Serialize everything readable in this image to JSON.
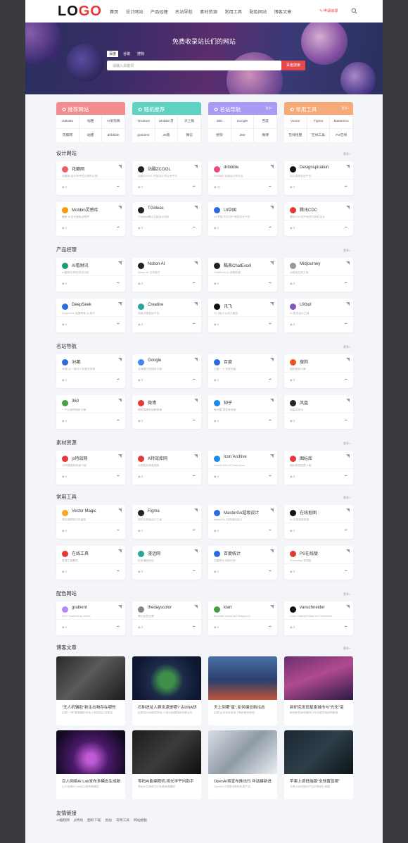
{
  "header": {
    "logo_a": "LO",
    "logo_b": "GO",
    "nav": [
      "首页",
      "设计网站",
      "产品经理",
      "名站导航",
      "素材资源",
      "常用工具",
      "配色网站",
      "博客文章"
    ],
    "apply": "✎ 申请收录"
  },
  "hero": {
    "title": "免费收录站长们的网站",
    "tabs": [
      "百度",
      "谷歌",
      "搜狗"
    ],
    "placeholder": "请输入关键词",
    "button": "百度搜索"
  },
  "categories": [
    {
      "title": "推荐网站",
      "color": "#f48b8e",
      "more": "",
      "items": [
        "JoBoBo",
        "站酷",
        "AI发现阁",
        "花瓣网",
        "站酷",
        "dribbble"
      ]
    },
    {
      "title": "随机推荐",
      "color": "#5fd3c3",
      "more": "",
      "items": [
        "TGideas",
        "Mobbin灵",
        "天上助",
        "grabient",
        "36氪",
        "微信"
      ]
    },
    {
      "title": "名站导航",
      "color": "#a99af5",
      "more": "更多+",
      "items": [
        "360",
        "Google",
        "百度",
        "搜狗",
        "360",
        "微博"
      ]
    },
    {
      "title": "常用工具",
      "color": "#f7aa78",
      "more": "更多+",
      "items": [
        "Vector",
        "Figma",
        "MasterGo",
        "在线抠图",
        "在线工具",
        "PS在线"
      ]
    }
  ],
  "more_label": "更多+",
  "sections": [
    {
      "title": "设计网站",
      "cards": [
        {
          "name": "花瓣网",
          "desc": "花瓣网,设计师寻找灵感的天堂!",
          "views": "0",
          "color": "#ef5f6a"
        },
        {
          "name": "站酷ZCOOL",
          "desc": "站酷ZCOOL,中国设计师互动平台",
          "views": "0",
          "color": "#222"
        },
        {
          "name": "dribbble",
          "desc": "Dribbble 全球设计师社区",
          "views": "41",
          "color": "#ea4c89"
        },
        {
          "name": "Designspiration",
          "desc": "设计灵感发现平台",
          "views": "0",
          "color": "#111"
        },
        {
          "name": "Mobbin灵感库",
          "desc": "最新 UI设计模板灵感库",
          "views": "0",
          "color": "#f39c12"
        },
        {
          "name": "TGideas",
          "desc": "TGideas腾讯互娱设计团队",
          "views": "0",
          "color": "#222"
        },
        {
          "name": "UI中国",
          "desc": "UI 中国,专业用户体验设计平台",
          "views": "0",
          "color": "#2d6cdf"
        },
        {
          "name": "腾讯CDC",
          "desc": "腾讯CDC用户研究与体验设计",
          "views": "0",
          "color": "#e53935"
        }
      ]
    },
    {
      "title": "产品经理",
      "cards": [
        {
          "name": "AI看财讯",
          "desc": "AI看财讯,财经资讯分析",
          "views": "0",
          "color": "#1b9e77"
        },
        {
          "name": "Notion AI",
          "desc": "Notion AI 写作助手",
          "views": "0",
          "color": "#222"
        },
        {
          "name": "酷表ChatExcel",
          "desc": "ChatExcel AI 表格处理",
          "views": "0",
          "color": "#222"
        },
        {
          "name": "Midjourney",
          "desc": "AI绘画生成工具",
          "views": "0",
          "color": "#999"
        },
        {
          "name": "DeepSeek",
          "desc": "DeepSeek 深度求索 AI 助手",
          "views": "0",
          "color": "#2d6cdf"
        },
        {
          "name": "Creative",
          "desc": "创意灵感发现平台",
          "views": "0",
          "color": "#26a69a"
        },
        {
          "name": "讯飞",
          "desc": "讯飞星火认知大模型",
          "views": "0",
          "color": "#111"
        },
        {
          "name": "UXbot",
          "desc": "AI 原型设计工具",
          "views": "0",
          "color": "#7e57c2"
        }
      ]
    },
    {
      "title": "名站导航",
      "cards": [
        {
          "name": "36氪",
          "desc": "36氪,让一部分人先看到未来",
          "views": "0",
          "color": "#2d6cdf"
        },
        {
          "name": "Google",
          "desc": "全球最大的搜索引擎",
          "views": "0",
          "color": "#4285f4"
        },
        {
          "name": "百度",
          "desc": "百度一下,你就知道",
          "views": "0",
          "color": "#2d6cdf"
        },
        {
          "name": "搜狗",
          "desc": "搜狗搜索引擎",
          "views": "0",
          "color": "#f4511e"
        },
        {
          "name": "360",
          "desc": "一个正经的搜索引擎",
          "views": "0",
          "color": "#43a047"
        },
        {
          "name": "微博",
          "desc": "随时随地发现新鲜事",
          "views": "0",
          "color": "#e53935"
        },
        {
          "name": "知乎",
          "desc": "有问题,就会有答案",
          "views": "0",
          "color": "#1e88e5"
        },
        {
          "name": "凤凰",
          "desc": "凤凰网资讯",
          "views": "0",
          "color": "#222"
        }
      ]
    },
    {
      "title": "素材资源",
      "cards": [
        {
          "name": "js特效网",
          "desc": "JS特效素材资源下载",
          "views": "0",
          "color": "#e53935"
        },
        {
          "name": "A特效库网",
          "desc": "AI特效资源素材库",
          "views": "0",
          "color": "#e53935"
        },
        {
          "name": "Icon Archive",
          "desc": "Search 590,673 free icons",
          "views": "1",
          "color": "#1e88e5"
        },
        {
          "name": "图标库",
          "desc": "图标素材免费下载",
          "views": "0",
          "color": "#e53935"
        }
      ]
    },
    {
      "title": "常用工具",
      "cards": [
        {
          "name": "Vector Magic",
          "desc": "将位图转换为矢量图",
          "views": "0",
          "color": "#f9a825"
        },
        {
          "name": "Figma",
          "desc": "协作式界面设计工具",
          "views": "0",
          "color": "#222"
        },
        {
          "name": "MasterGo超级设计",
          "desc": "MasterGo 在线协同设计",
          "views": "0",
          "color": "#2d6cdf"
        },
        {
          "name": "在线抠图",
          "desc": "AI 在线智能抠图",
          "views": "0",
          "color": "#111"
        },
        {
          "name": "在线工具",
          "desc": "在线工具集合",
          "views": "0",
          "color": "#e53935"
        },
        {
          "name": "漫话网",
          "desc": "在线漫画阅读",
          "views": "0",
          "color": "#26a69a"
        },
        {
          "name": "百度统计",
          "desc": "百度统计 网站分析",
          "views": "0",
          "color": "#2d6cdf"
        },
        {
          "name": "PS在线版",
          "desc": "Photoshop 在线版",
          "views": "0",
          "color": "#e53935"
        }
      ]
    },
    {
      "title": "配色网站",
      "cards": [
        {
          "name": "grabient",
          "desc": "2017 Grabient by unfold",
          "views": "0",
          "color": "#b388ff"
        },
        {
          "name": "thedayscolor",
          "desc": "每日配色灵感",
          "views": "0",
          "color": "#888"
        },
        {
          "name": "klart",
          "desc": "Beautiful colors and designs to",
          "views": "0",
          "color": "#43a047"
        },
        {
          "name": "vanschneider",
          "desc": "Color Claim@Tobias van Schneider",
          "views": "0",
          "color": "#111"
        }
      ]
    }
  ],
  "blog_title": "博客文章",
  "blogs": [
    {
      "title": "\"无人机辅助\"新生出物存在哪些",
      "desc": "近期,一种\"增强辅助\"的无人机应用正在热议",
      "bg": "linear-gradient(135deg,#2a2a2a,#5a5a5a 45%,#1b1b1b)"
    },
    {
      "title": "石斛进址人群发源是哪? 古DNA研",
      "desc": "近期古DNA研究发现,人类迁徙路线再次被证实",
      "bg": "radial-gradient(circle at 50% 55%,#3e8f4a 18%,#1d2b4a 40%,#0f1730 80%)"
    },
    {
      "title": "天上到哪\"星\",如何编动新论态",
      "desc": "近期,天文学家发现了新的星系结构",
      "bg": "linear-gradient(180deg,#4a6fa8,#2b3f6e 55%,#c0553b)"
    },
    {
      "title": "新研究发现星座城市与\"光化\"变",
      "desc": "新的研究表明城市灯光对星空观测的影响",
      "bg": "linear-gradient(160deg,#6a2e6e,#b14a8f 45%,#2a1a44)"
    },
    {
      "title": "巨人网络AI Lab发布多模态生成新",
      "desc": "巨人网络AI Lab近日发布新模型",
      "bg": "radial-gradient(circle at 50% 65%,#c15bd6 10%,#4a1a6a 40%,#120920 85%)"
    },
    {
      "title": "零码AI能编程师,将光学干问助手",
      "desc": "零码AI工具助力开发者高效编程",
      "bg": "linear-gradient(135deg,#1d1d1d,#3b3b3b 50%,#0f0f0f)"
    },
    {
      "title": "OpenAI将宣布推出行 年话建新进",
      "desc": "OpenAI 计划推出新的年度产品",
      "bg": "linear-gradient(135deg,#d8dde3,#8f9aa6 50%,#e9eef2)"
    },
    {
      "title": "苹果上调低端版\"全球置显眼\"",
      "desc": "苹果公司对部分产品价格进行调整",
      "bg": "linear-gradient(135deg,#1a2630,#2e3f4a 50%,#0d1418)"
    }
  ],
  "friend_title": "友情链接",
  "friend_links": [
    "AI编程网",
    "js特效",
    "图标下载",
    "优站",
    "常用工具",
    "网站模板"
  ]
}
